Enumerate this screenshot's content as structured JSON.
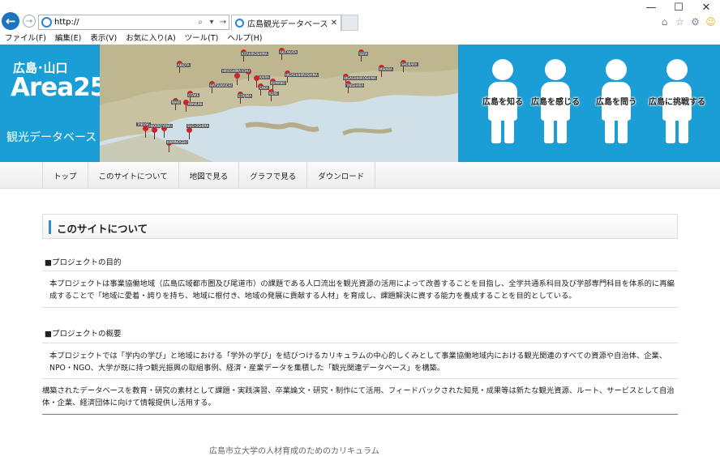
{
  "browser": {
    "url": "http://",
    "tab_title": "広島観光データベース",
    "menu": [
      "ファイル(F)",
      "編集(E)",
      "表示(V)",
      "お気に入り(A)",
      "ツール(T)",
      "ヘルプ(H)"
    ]
  },
  "header": {
    "logo_line1": "広島･山口",
    "logo_line2": "Area25",
    "logo_line3": "観光データベース",
    "map_pins": [
      "AKIOTA",
      "KITAHIROSHIMA",
      "AKITAKATA",
      "SERA",
      "SHOBARA",
      "MIHARA",
      "ONOMICHI",
      "HIGASHIHIROSHIMA",
      "TAKEHARA",
      "OSAKIKAMIJIMA",
      "KUMANO",
      "KAIRA",
      "FUCHU",
      "HIROSHIMA",
      "SAKA",
      "KURE",
      "ETAJIMA",
      "HATSUKAICHI",
      "OTAKE",
      "IWAKUNI",
      "WAKI",
      "TABUSE",
      "HIKARI",
      "YANAI",
      "SUO-OSHIMA",
      "KAMINOSEKI"
    ],
    "figures": [
      "広島を知る",
      "広島を感じる",
      "広島を問う",
      "広島に挑戦する"
    ]
  },
  "nav": [
    "トップ",
    "このサイトについて",
    "地図で見る",
    "グラフで見る",
    "ダウンロード"
  ],
  "main": {
    "heading": "このサイトについて",
    "section1_title": "■プロジェクトの目的",
    "section1_text": "本プロジェクトは事業協働地域（広島広域都市圏及び尾道市）の課題である人口流出を観光資源の活用によって改善することを目指し、全学共通系科目及び学部専門科目を体系的に再編成することで「地域に愛着・誇りを持ち、地域に根付き、地域の発展に貢献する人材」を育成し、課題解決に資する能力を養成することを目的としている。",
    "section2_title": "■プロジェクトの概要",
    "section2_text": "本プロジェクトでは「学内の学び」と地域における「学外の学び」を結びつけるカリキュラムの中心的しくみとして事業協働地域内における観光関連のすべての資源や自治体、企業、NPO・NGO、大学が既に持つ観光振興の取組事例、経済・産業データを集積した「観光関連データベース」を構築。",
    "section3_text": "構築されたデータベースを教育・研究の素材として課題・実践演習、卒業論文・研究・制作にて活用、フィードバックされた知見・成果等は新たな観光資源、ルート、サービスとして自治体・企業、経済団体に向けて情報提供し活用する。",
    "footer_text": "広島市立大学の人材育成のためのカリキュラム"
  }
}
